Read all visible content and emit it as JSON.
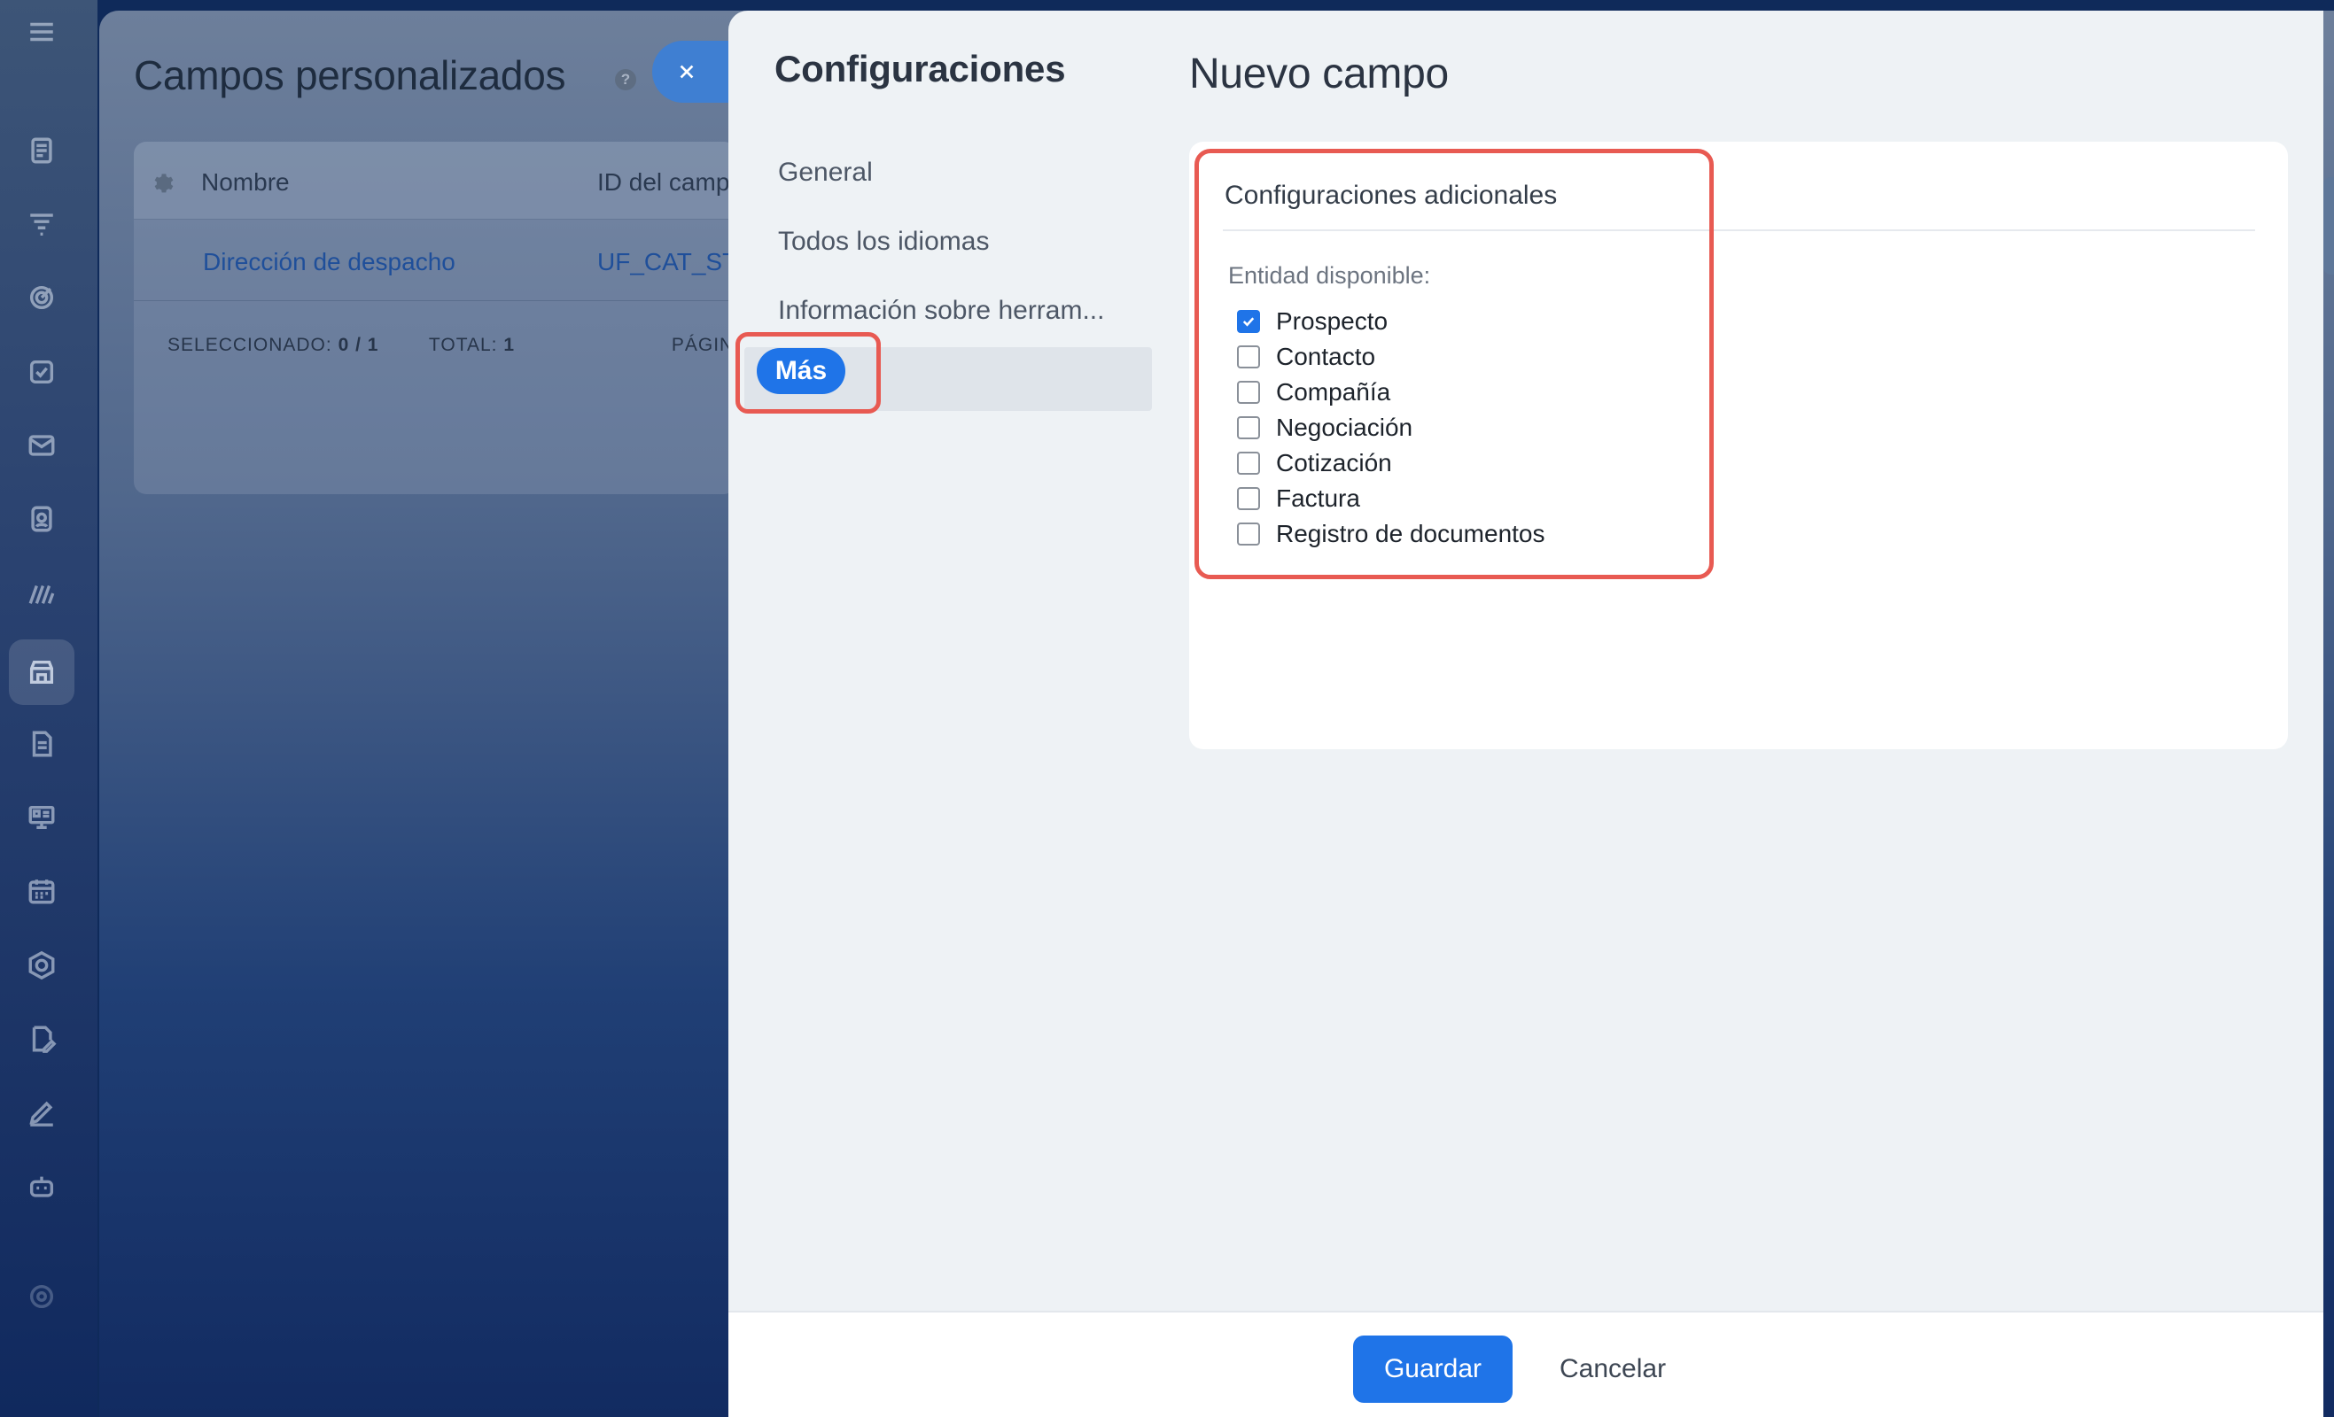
{
  "rail": {
    "icons": [
      "menu-icon",
      "feed-icon",
      "funnel-icon",
      "target-icon",
      "tasks-icon",
      "mail-icon",
      "contacts-icon",
      "analytics-icon",
      "store-icon",
      "document-icon",
      "presentation-icon",
      "calendar-icon",
      "hexagon-icon",
      "document-edit-icon",
      "pen-icon",
      "robot-icon",
      "settings-icon"
    ]
  },
  "background": {
    "title": "Campos personalizados",
    "help": "?",
    "table": {
      "columns": [
        "Nombre",
        "ID del camp"
      ],
      "rows": [
        {
          "name": "Dirección de despacho",
          "id": "UF_CAT_ST"
        }
      ],
      "footer": {
        "selected_label": "SELECCIONADO:",
        "selected_value": "0 / 1",
        "total_label": "TOTAL:",
        "total_value": "1",
        "page_label": "PÁGIN"
      }
    }
  },
  "panel": {
    "nav_title": "Configuraciones",
    "nav_items": [
      "General",
      "Todos los idiomas",
      "Información sobre herram...",
      "Más"
    ],
    "form_title": "Nuevo campo",
    "section_title": "Configuraciones adicionales",
    "entity_label": "Entidad disponible:",
    "entities": [
      {
        "label": "Prospecto",
        "checked": true
      },
      {
        "label": "Contacto",
        "checked": false
      },
      {
        "label": "Compañía",
        "checked": false
      },
      {
        "label": "Negociación",
        "checked": false
      },
      {
        "label": "Cotización",
        "checked": false
      },
      {
        "label": "Factura",
        "checked": false
      },
      {
        "label": "Registro de documentos",
        "checked": false
      }
    ]
  },
  "footer": {
    "save": "Guardar",
    "cancel": "Cancelar"
  },
  "colors": {
    "accent": "#1f74e8",
    "highlight": "#e85a52"
  }
}
